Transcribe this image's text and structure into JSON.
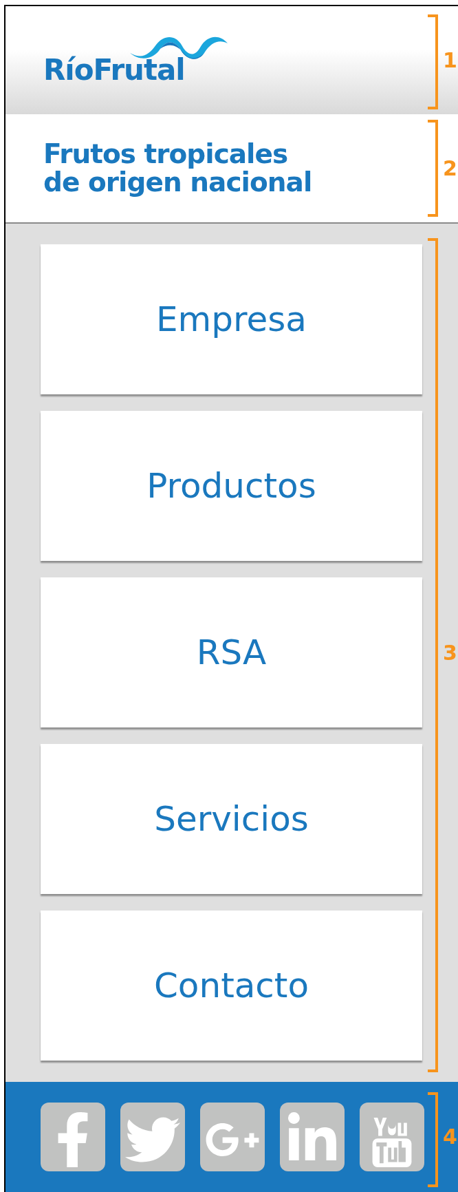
{
  "header": {
    "logo": "RíoFrutal",
    "annotation": "1"
  },
  "tagline": {
    "lines": [
      "Frutos tropicales",
      "de origen nacional"
    ],
    "annotation": "2"
  },
  "menu": {
    "items": [
      {
        "label": "Empresa"
      },
      {
        "label": "Productos"
      },
      {
        "label": "RSA"
      },
      {
        "label": "Servicios"
      },
      {
        "label": "Contacto"
      }
    ],
    "annotation": "3"
  },
  "footer": {
    "social": [
      {
        "kind": "facebook"
      },
      {
        "kind": "twitter"
      },
      {
        "kind": "googleplus"
      },
      {
        "kind": "linkedin"
      },
      {
        "kind": "youtube"
      }
    ],
    "annotation": "4"
  }
}
